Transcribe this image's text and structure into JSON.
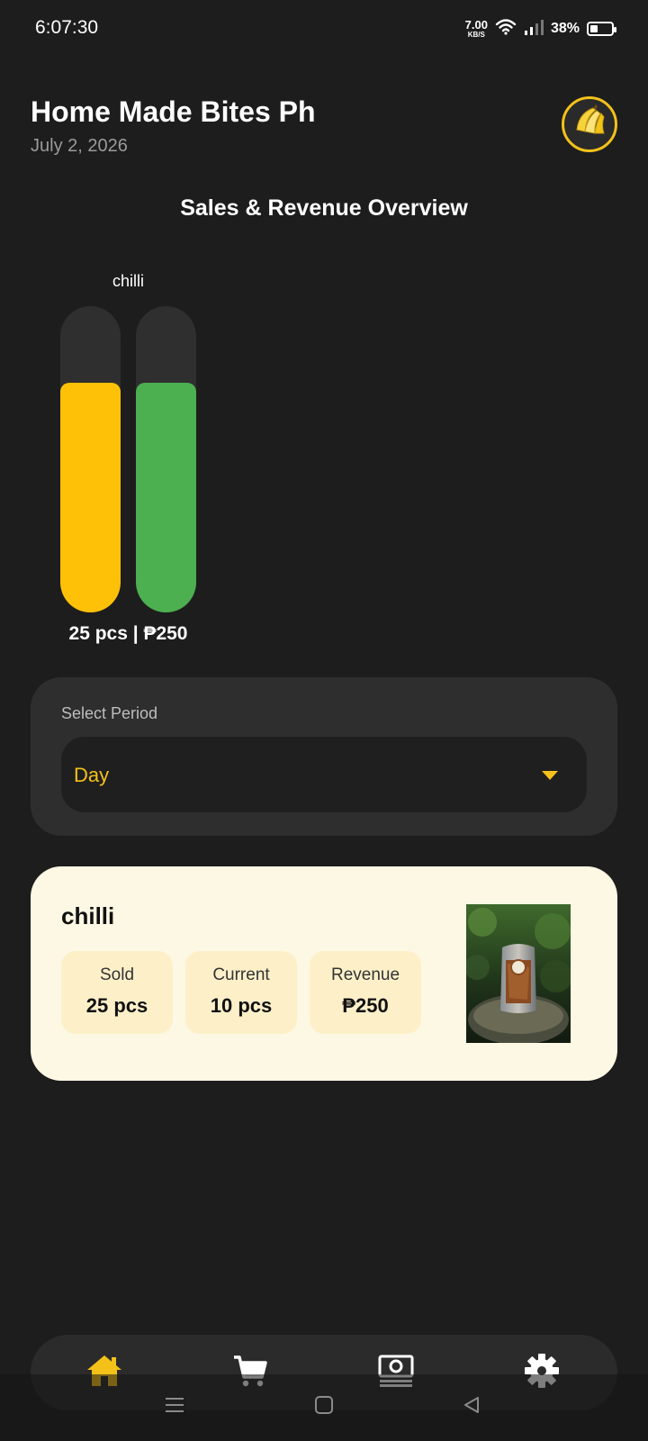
{
  "status_bar": {
    "time": "6:07:30",
    "net_speed_value": "7.00",
    "net_speed_unit": "KB/S",
    "battery_percent": "38%",
    "battery_level": 0.38
  },
  "header": {
    "title": "Home Made Bites Ph",
    "date": "July 2, 2026",
    "avatar_icon": "banana-icon"
  },
  "chart_title": "Sales & Revenue Overview",
  "chart_data": {
    "type": "bar",
    "categories": [
      "chilli"
    ],
    "series": [
      {
        "values": [
          25
        ],
        "color": "#FFC107"
      },
      {
        "values": [
          250
        ],
        "color": "#4CAF50"
      }
    ],
    "value_labels": [
      "25 pcs | ₱250"
    ],
    "fill_fraction": [
      0.75,
      0.75
    ]
  },
  "period": {
    "label": "Select Period",
    "selected": "Day"
  },
  "product": {
    "name": "chilli",
    "stats": [
      {
        "label": "Sold",
        "value": "25 pcs"
      },
      {
        "label": "Current",
        "value": "10 pcs"
      },
      {
        "label": "Revenue",
        "value": "₱250"
      }
    ],
    "photo_icon": "product-photo"
  },
  "nav": {
    "items": [
      {
        "icon": "home-icon",
        "active": true
      },
      {
        "icon": "cart-icon",
        "active": false
      },
      {
        "icon": "cash-icon",
        "active": false
      },
      {
        "icon": "settings-icon",
        "active": false
      }
    ]
  },
  "colors": {
    "accent": "#F3C11A",
    "bar_units": "#FFC107",
    "bar_revenue": "#4CAF50",
    "background": "#1D1D1D"
  }
}
